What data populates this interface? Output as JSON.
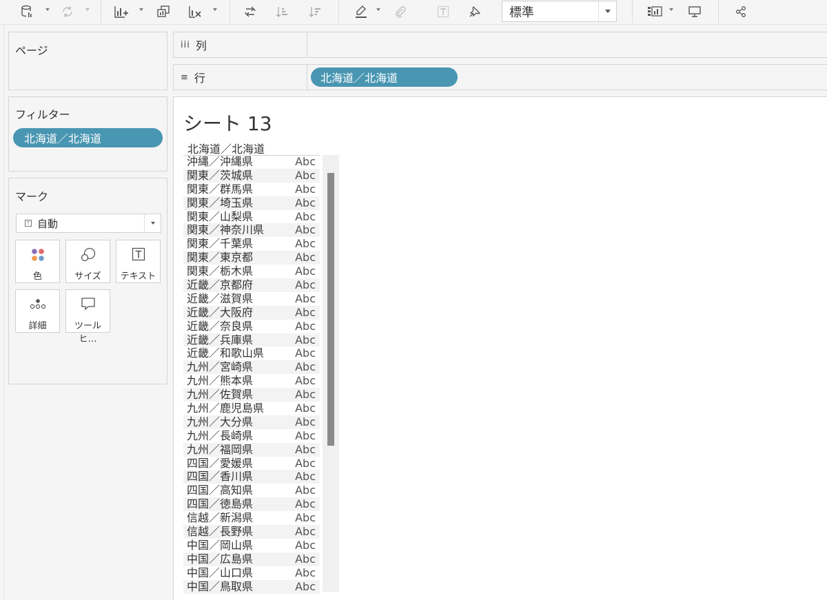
{
  "toolbar": {
    "fit_value": "標準",
    "icons": [
      "datasource-icon",
      "refresh-icon",
      "new-sheet-icon",
      "duplicate-sheet-icon",
      "clear-sheet-icon",
      "swap-icon",
      "sort-asc-icon",
      "sort-desc-icon",
      "highlight-icon",
      "paperclip-icon",
      "label-icon",
      "pin-icon",
      "show-cards-icon",
      "presentation-icon",
      "share-icon"
    ]
  },
  "cards": {
    "pages_title": "ページ",
    "filters_title": "フィルター",
    "filter_pill": "北海道／北海道",
    "marks_title": "マーク",
    "marks_type": "自動",
    "mark_buttons": {
      "color": "色",
      "size": "サイズ",
      "text": "テキスト",
      "detail": "詳細",
      "tooltip": "ツールヒ…"
    }
  },
  "shelves": {
    "columns_label": "列",
    "rows_label": "行",
    "rows_pill": "北海道／北海道"
  },
  "view": {
    "sheet_title": "シート 13",
    "column_header": "北海道／北海道",
    "cell_value": "Abc",
    "rows": [
      "沖縄／沖縄県",
      "関東／茨城県",
      "関東／群馬県",
      "関東／埼玉県",
      "関東／山梨県",
      "関東／神奈川県",
      "関東／千葉県",
      "関東／東京都",
      "関東／栃木県",
      "近畿／京都府",
      "近畿／滋賀県",
      "近畿／大阪府",
      "近畿／奈良県",
      "近畿／兵庫県",
      "近畿／和歌山県",
      "九州／宮崎県",
      "九州／熊本県",
      "九州／佐賀県",
      "九州／鹿児島県",
      "九州／大分県",
      "九州／長崎県",
      "九州／福岡県",
      "四国／愛媛県",
      "四国／香川県",
      "四国／高知県",
      "四国／徳島県",
      "信越／新潟県",
      "信越／長野県",
      "中国／岡山県",
      "中国／広島県",
      "中国／山口県",
      "中国／鳥取県"
    ]
  },
  "colors": {
    "pill": "#4996b2",
    "scrollbar_thumb": "#8a8a8a"
  }
}
